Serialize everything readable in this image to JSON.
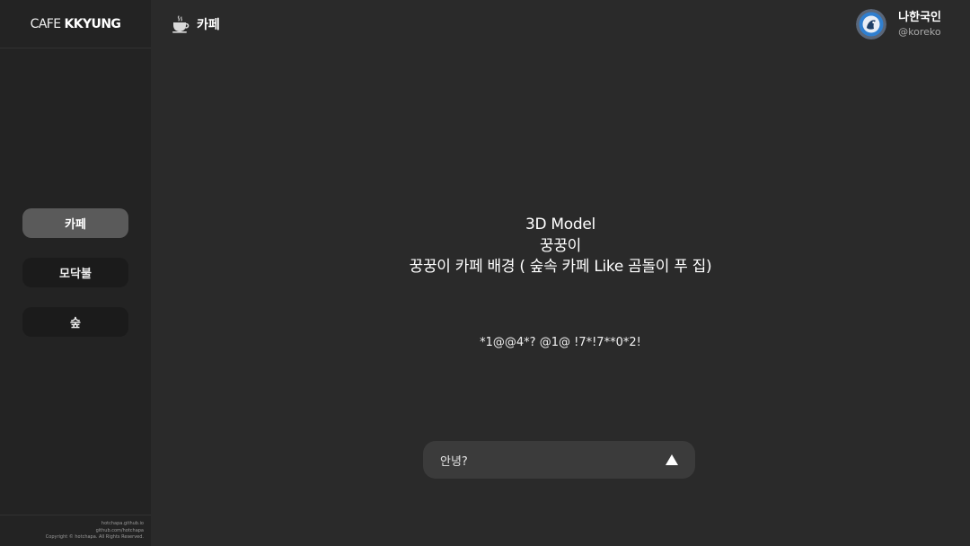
{
  "brand": {
    "light": "CAFE",
    "bold": "KKYUNG"
  },
  "header": {
    "title": "카페",
    "title_icon": "coffee-cup-icon"
  },
  "user": {
    "name": "나한국인",
    "handle": "@koreko"
  },
  "sidebar": {
    "items": [
      {
        "label": "카페",
        "active": true
      },
      {
        "label": "모닥불",
        "active": false
      },
      {
        "label": "숲",
        "active": false
      }
    ]
  },
  "main": {
    "lines": [
      "3D Model",
      "꿍꿍이",
      "꿍꿍이 카페 배경 ( 숲속 카페 Like 곰돌이 푸 집)"
    ],
    "code": "*1@@4*? @1@ !7*!7**0*2!"
  },
  "chat": {
    "value": "안녕?",
    "send_icon": "triangle-up-icon"
  },
  "footer": {
    "lines": [
      "hotchapa.github.io",
      "github.com/hotchapa",
      "Copyright © hotchapa. All Rights Reserved."
    ]
  },
  "colors": {
    "background": "#2a2a2a",
    "sidebar": "#232323",
    "nav_active": "#5a5a5a",
    "nav_inactive": "#1b1b1b",
    "chat_bg": "#3b3b3b"
  }
}
